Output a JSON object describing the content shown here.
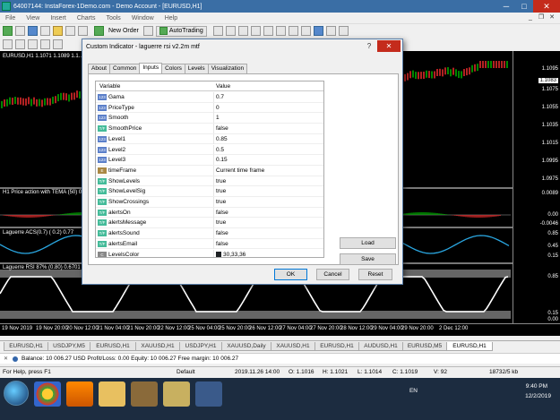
{
  "window": {
    "title": "64007144: InstaForex-1Demo.com - Demo Account - [EURUSD,H1]",
    "minimize": "─",
    "maximize": "□",
    "close": "✕"
  },
  "menu": {
    "items": [
      "File",
      "View",
      "Insert",
      "Charts",
      "Tools",
      "Window",
      "Help"
    ],
    "mdi": [
      "_",
      "❐",
      "✕"
    ]
  },
  "toolbar": {
    "new_order": "New Order",
    "autotrading": "AutoTrading"
  },
  "chart": {
    "main_label": "EURUSD,H1  1.1071 1.1089 1.1...",
    "tema_label": "H1 Price action with TEMA (50) 0.0...",
    "acs_label": "Laguerre ACS(0.7) ( 0.2) 0.77",
    "rsi_label": "Laguerre RSI 87% (0.80) 0.6701",
    "axis_ticks": [
      {
        "label": "1.1095"
      },
      {
        "label": "1.1083",
        "current": true
      },
      {
        "label": "1.1075"
      },
      {
        "label": "1.1055"
      },
      {
        "label": "1.1035"
      },
      {
        "label": "1.1015"
      },
      {
        "label": "1.0995"
      },
      {
        "label": "1.0975"
      },
      {
        "label": "0.0089"
      },
      {
        "label": "0.00"
      },
      {
        "label": "-0.0046"
      },
      {
        "label": "0.85"
      },
      {
        "label": "0.45"
      },
      {
        "label": "0.15"
      },
      {
        "label": "0.85"
      },
      {
        "label": "0.15"
      },
      {
        "label": "0.00"
      }
    ],
    "time_labels": [
      "19 Nov 2019",
      "19 Nov 20:00",
      "20 Nov 12:00",
      "21 Nov 04:00",
      "21 Nov 20:00",
      "22 Nov 12:00",
      "25 Nov 04:00",
      "25 Nov 20:00",
      "26 Nov 12:00",
      "27 Nov 04:00",
      "27 Nov 20:00",
      "28 Nov 12:00",
      "29 Nov 04:00",
      "29 Nov 20:00",
      "2 Dec 12:00"
    ],
    "colors": {
      "bull": "#00c000",
      "bear": "#ff3030",
      "acs": "#2aa6e0",
      "rsi": "#ffffff"
    }
  },
  "tabs": [
    "EURUSD,H1",
    "USDJPY,M5",
    "EURUSD,H1",
    "XAUUSD,H1",
    "USDJPY,H1",
    "XAUUSD,Daily",
    "XAUUSD,H1",
    "EURUSD,H1",
    "AUDUSD,H1",
    "EURUSD,M5",
    "EURUSD,H1"
  ],
  "active_tab_index": 10,
  "terminal": {
    "close_glyph": "✕",
    "balance_line": "Balance: 10 006.27 USD  Profit/Loss: 0.00  Equity: 10 006.27  Free margin: 10 006.27"
  },
  "status": {
    "help": "For Help, press F1",
    "profile": "Default",
    "datetime": "2019.11.26 14:00",
    "open": "O: 1.1016",
    "high": "H: 1.1021",
    "low": "L: 1.1014",
    "close": "C: 1.1019",
    "volume": "V: 92",
    "traffic": "18732/5 kb"
  },
  "tray": {
    "lang": "EN",
    "time": "9:40 PM",
    "date": "12/2/2019"
  },
  "dialog": {
    "title": "Custom Indicator - laguerre rsi v2.2m mtf",
    "help": "?",
    "close": "✕",
    "tabs": [
      "About",
      "Common",
      "Inputs",
      "Colors",
      "Levels",
      "Visualization"
    ],
    "active_tab": 2,
    "columns": {
      "variable": "Variable",
      "value": "Value"
    },
    "inputs": [
      {
        "type": "num",
        "tag": "123",
        "name": "Gama",
        "value": "0.7"
      },
      {
        "type": "num",
        "tag": "123",
        "name": "PriceType",
        "value": "0"
      },
      {
        "type": "num",
        "tag": "123",
        "name": "Smooth",
        "value": "1"
      },
      {
        "type": "bool",
        "tag": "T/F",
        "name": "SmoothPrice",
        "value": "false"
      },
      {
        "type": "num",
        "tag": "123",
        "name": "Level1",
        "value": "0.85"
      },
      {
        "type": "num",
        "tag": "123",
        "name": "Level2",
        "value": "0.5"
      },
      {
        "type": "num",
        "tag": "123",
        "name": "Level3",
        "value": "0.15"
      },
      {
        "type": "enm",
        "tag": "E",
        "name": "timeFrame",
        "value": "Current time frame"
      },
      {
        "type": "bool",
        "tag": "T/F",
        "name": "ShowLevels",
        "value": "true"
      },
      {
        "type": "bool",
        "tag": "T/F",
        "name": "ShowLevelSig",
        "value": "true"
      },
      {
        "type": "bool",
        "tag": "T/F",
        "name": "ShowCrossings",
        "value": "true"
      },
      {
        "type": "bool",
        "tag": "T/F",
        "name": "alertsOn",
        "value": "false"
      },
      {
        "type": "bool",
        "tag": "T/F",
        "name": "alertsMessage",
        "value": "true"
      },
      {
        "type": "bool",
        "tag": "T/F",
        "name": "alertsSound",
        "value": "false"
      },
      {
        "type": "bool",
        "tag": "T/F",
        "name": "alertsEmail",
        "value": "false"
      },
      {
        "type": "clr",
        "tag": "C",
        "name": "LevelsColor",
        "value": "30,33,36",
        "swatch": "#1e2124"
      }
    ],
    "load": "Load",
    "save": "Save",
    "ok": "OK",
    "cancel": "Cancel",
    "reset": "Reset"
  }
}
